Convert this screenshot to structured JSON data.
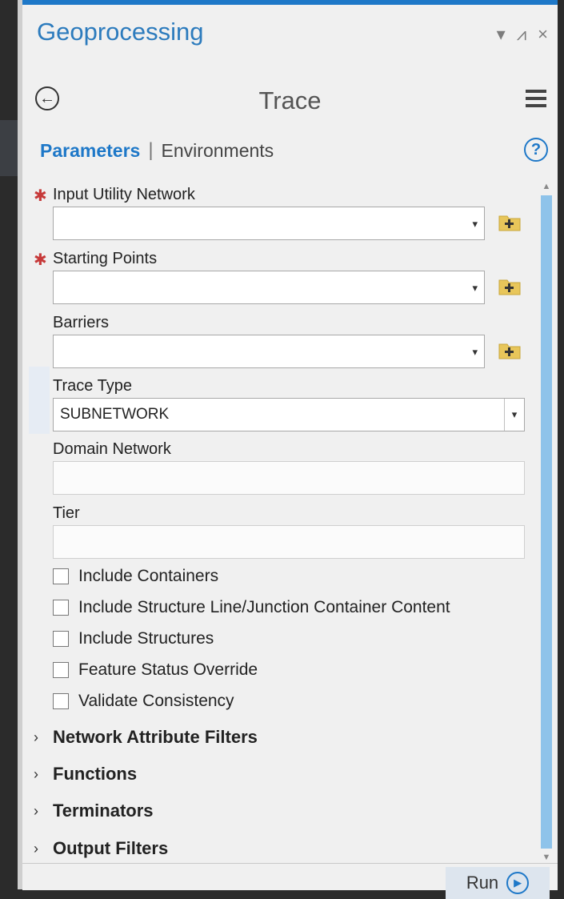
{
  "pane": {
    "title": "Geoprocessing",
    "controls": {
      "dropdown_icon": "▾",
      "pin_icon": "⩘",
      "close_icon": "×"
    }
  },
  "tool": {
    "title": "Trace"
  },
  "tabs": {
    "parameters": "Parameters",
    "environments": "Environments",
    "help": "?"
  },
  "parameters": {
    "input_utility_network": {
      "label": "Input Utility Network",
      "value": "",
      "required": true
    },
    "starting_points": {
      "label": "Starting Points",
      "value": "",
      "required": true
    },
    "barriers": {
      "label": "Barriers",
      "value": ""
    },
    "trace_type": {
      "label": "Trace Type",
      "value": "SUBNETWORK"
    },
    "domain_network": {
      "label": "Domain Network",
      "value": ""
    },
    "tier": {
      "label": "Tier",
      "value": ""
    }
  },
  "checkboxes": [
    {
      "label": "Include Containers",
      "checked": false
    },
    {
      "label": "Include Structure Line/Junction Container Content",
      "checked": false
    },
    {
      "label": "Include Structures",
      "checked": false
    },
    {
      "label": "Feature Status Override",
      "checked": false
    },
    {
      "label": "Validate Consistency",
      "checked": false
    }
  ],
  "sections": [
    {
      "label": "Network Attribute Filters",
      "expanded": false
    },
    {
      "label": "Functions",
      "expanded": false
    },
    {
      "label": "Terminators",
      "expanded": false
    },
    {
      "label": "Output Filters",
      "expanded": false
    }
  ],
  "footer": {
    "run_label": "Run"
  },
  "icons": {
    "required": "✱",
    "dropdown": "▾",
    "chevron": "›",
    "back": "←",
    "run": "▶"
  },
  "colors": {
    "accent": "#1e78c8",
    "required": "#c73a3a",
    "add_icon": "#e8c65a",
    "scroll_thumb": "#8ec3ea"
  }
}
